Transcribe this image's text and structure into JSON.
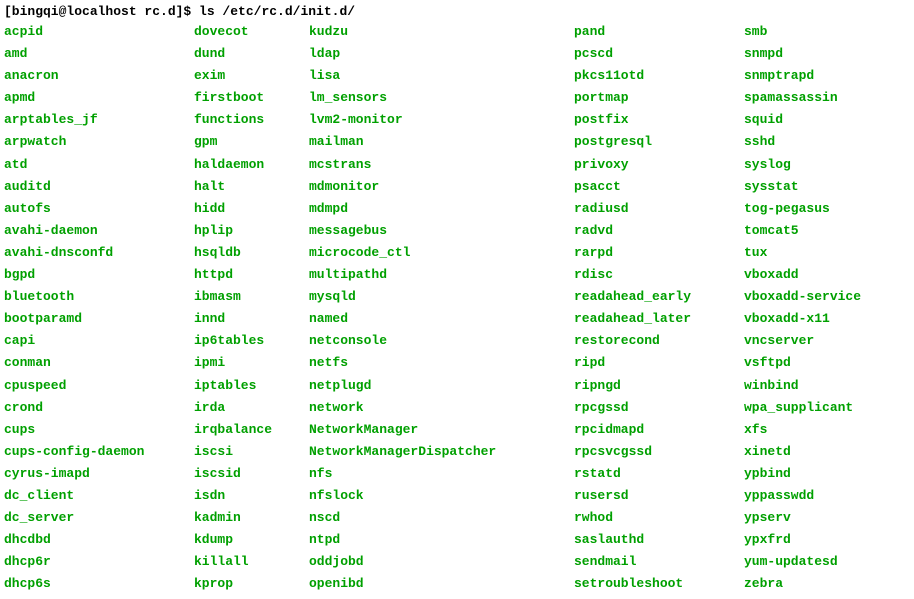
{
  "prompt": "[bingqi@localhost rc.d]$ ls /etc/rc.d/init.d/",
  "col1": [
    "acpid",
    "amd",
    "anacron",
    "apmd",
    "arptables_jf",
    "arpwatch",
    "atd",
    "auditd",
    "autofs",
    "avahi-daemon",
    "avahi-dnsconfd",
    "bgpd",
    "bluetooth",
    "bootparamd",
    "capi",
    "conman",
    "cpuspeed",
    "crond",
    "cups",
    "cups-config-daemon",
    "cyrus-imapd",
    "dc_client",
    "dc_server",
    "dhcdbd",
    "dhcp6r",
    "dhcp6s"
  ],
  "col2": [
    "dovecot",
    "dund",
    "exim",
    "firstboot",
    "functions",
    "gpm",
    "haldaemon",
    "halt",
    "hidd",
    "hplip",
    "hsqldb",
    "httpd",
    "ibmasm",
    "innd",
    "ip6tables",
    "ipmi",
    "iptables",
    "irda",
    "irqbalance",
    "iscsi",
    "iscsid",
    "isdn",
    "kadmin",
    "kdump",
    "killall",
    "kprop"
  ],
  "col3": [
    "kudzu",
    "ldap",
    "lisa",
    "lm_sensors",
    "lvm2-monitor",
    "mailman",
    "mcstrans",
    "mdmonitor",
    "mdmpd",
    "messagebus",
    "microcode_ctl",
    "multipathd",
    "mysqld",
    "named",
    "netconsole",
    "netfs",
    "netplugd",
    "network",
    "NetworkManager",
    "NetworkManagerDispatcher",
    "nfs",
    "nfslock",
    "nscd",
    "ntpd",
    "oddjobd",
    "openibd"
  ],
  "col4": [
    "pand",
    "pcscd",
    "pkcs11otd",
    "portmap",
    "postfix",
    "postgresql",
    "privoxy",
    "psacct",
    "radiusd",
    "radvd",
    "rarpd",
    "rdisc",
    "readahead_early",
    "readahead_later",
    "restorecond",
    "ripd",
    "ripngd",
    "rpcgssd",
    "rpcidmapd",
    "rpcsvcgssd",
    "rstatd",
    "rusersd",
    "rwhod",
    "saslauthd",
    "sendmail",
    "setroubleshoot"
  ],
  "col5": [
    "smb",
    "snmpd",
    "snmptrapd",
    "spamassassin",
    "squid",
    "sshd",
    "syslog",
    "sysstat",
    "tog-pegasus",
    "tomcat5",
    "tux",
    "vboxadd",
    "vboxadd-service",
    "vboxadd-x11",
    "vncserver",
    "vsftpd",
    "winbind",
    "wpa_supplicant",
    "xfs",
    "xinetd",
    "ypbind",
    "yppasswdd",
    "ypserv",
    "ypxfrd",
    "yum-updatesd",
    "zebra"
  ]
}
